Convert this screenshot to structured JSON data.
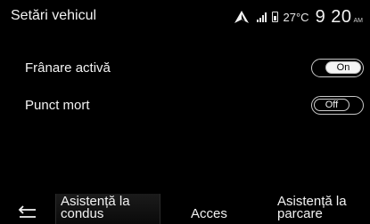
{
  "header": {
    "title": "Setări vehicul",
    "temperature": "27°C",
    "time": "9 20",
    "time_suffix": "AM"
  },
  "settings": [
    {
      "label": "Frânare activă",
      "state": "On"
    },
    {
      "label": "Punct mort",
      "state": "Off"
    }
  ],
  "bottom_bar": {
    "tabs": {
      "driving_line1": "Asistență la",
      "driving_line2": "condus",
      "access": "Acces",
      "parking_line1": "Asistență la",
      "parking_line2": "parcare"
    },
    "back_icon": "back-arrow-icon"
  },
  "icons": {
    "navigation": "navigation-arrow-icon",
    "signal": "signal-strength-icon",
    "phone": "phone-battery-icon"
  }
}
